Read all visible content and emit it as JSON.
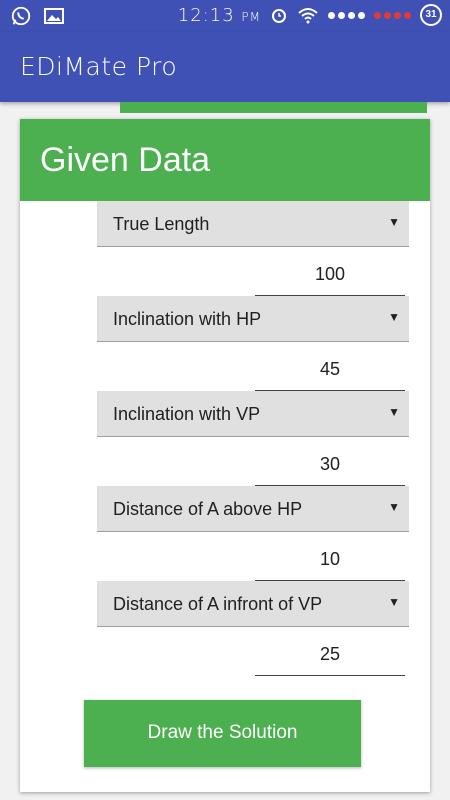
{
  "status_bar": {
    "time": "12:13",
    "ampm": "PM",
    "battery": "31"
  },
  "app_bar": {
    "title": "EDiMate Pro"
  },
  "card": {
    "title": "Given Data",
    "fields": [
      {
        "label": "True Length",
        "value": "100"
      },
      {
        "label": "Inclination with HP",
        "value": "45"
      },
      {
        "label": "Inclination with VP",
        "value": "30"
      },
      {
        "label": "Distance of A above HP",
        "value": "10"
      },
      {
        "label": "Distance of A infront of VP",
        "value": "25"
      }
    ],
    "dropdown_arrow": "▼"
  },
  "actions": {
    "draw_button": "Draw the Solution"
  }
}
